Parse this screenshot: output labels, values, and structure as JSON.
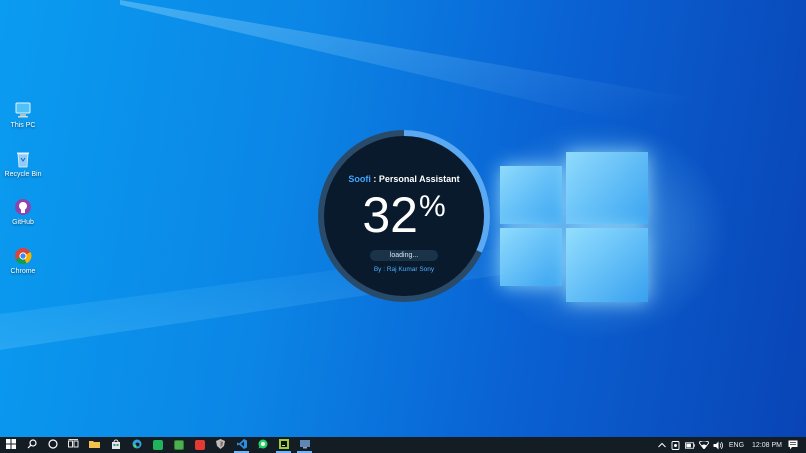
{
  "desktop": {
    "icons": [
      {
        "label": "This PC",
        "icon": "this-pc-icon"
      },
      {
        "label": "Recycle Bin",
        "icon": "recycle-bin-icon"
      },
      {
        "label": "GitHub",
        "icon": "github-icon"
      },
      {
        "label": "Chrome",
        "icon": "chrome-icon"
      }
    ]
  },
  "splash": {
    "brand": "Soofi",
    "separator": " : ",
    "subtitle": "Personal Assistant",
    "percent_value": "32",
    "percent_symbol": "%",
    "progress": 0.32,
    "loading_text": "loading...",
    "credit": "By :  Raj Kumar Sony",
    "colors": {
      "accent": "#3fa6ff",
      "ring_track": "#2a4a6a",
      "ring_fill": "#5aa9f2",
      "panel": "#081a2c"
    }
  },
  "taskbar": {
    "buttons": [
      {
        "name": "start-button",
        "icon": "windows-start-icon"
      },
      {
        "name": "search-button",
        "icon": "search-icon"
      },
      {
        "name": "cortana-button",
        "icon": "cortana-circle-icon"
      },
      {
        "name": "task-view-button",
        "icon": "task-view-icon"
      },
      {
        "name": "file-explorer-button",
        "icon": "folder-icon",
        "color": "#f2c14e"
      },
      {
        "name": "store-button",
        "icon": "store-bag-icon",
        "color": "#e6e6e6"
      },
      {
        "name": "edge-button",
        "icon": "edge-icon",
        "color": "#2fa3e0"
      },
      {
        "name": "app-green-button",
        "icon": "green-app-icon",
        "color": "#21b35b"
      },
      {
        "name": "app-android-button",
        "icon": "android-app-icon",
        "color": "#4caf50"
      },
      {
        "name": "app-red-button",
        "icon": "red-app-icon",
        "color": "#e53935"
      },
      {
        "name": "app-shield-button",
        "icon": "shield-app-icon",
        "color": "#9e9e9e"
      },
      {
        "name": "vscode-button",
        "icon": "vscode-icon",
        "color": "#2a8fe0",
        "active": true
      },
      {
        "name": "whatsapp-button",
        "icon": "whatsapp-icon",
        "color": "#25d366"
      },
      {
        "name": "pycharm-button",
        "icon": "pycharm-icon",
        "color": "#9ccc3a",
        "active": true
      },
      {
        "name": "app-running-button",
        "icon": "running-app-icon",
        "color": "#5c87b8",
        "active": true
      }
    ],
    "tray": {
      "language": "ENG",
      "time": "12:08 PM",
      "icons": [
        "chevron-up-icon",
        "device-icon",
        "battery-icon",
        "wifi-icon",
        "volume-icon"
      ]
    }
  }
}
